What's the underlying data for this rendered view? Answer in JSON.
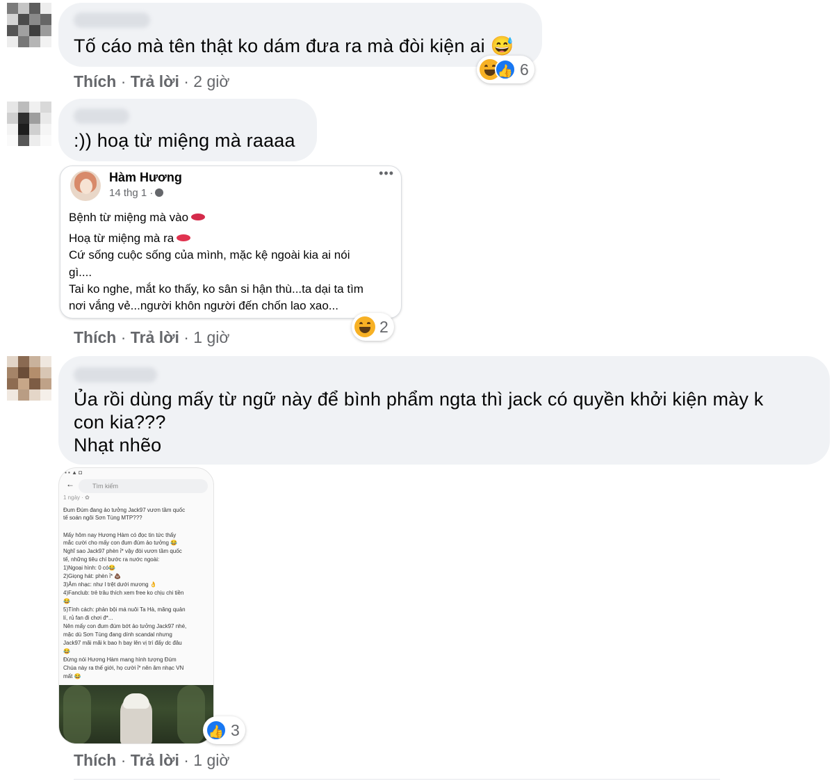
{
  "comments": [
    {
      "text": "Tố cáo mà tên thật ko dám đưa ra mà đòi kiện ai 😅",
      "actions": {
        "like": "Thích",
        "reply": "Trả lời",
        "time": "2 giờ"
      },
      "reactions": {
        "icons": [
          "haha-icon",
          "like-icon"
        ],
        "count": "6"
      }
    },
    {
      "text": ":)) hoạ từ miệng mà raaaa",
      "shared_post": {
        "author": "Hàm Hương",
        "meta": "14 thg 1 ·",
        "more": "•••",
        "lines": [
          "Bệnh từ miệng mà vào",
          "Hoạ từ miệng mà ra",
          "Cứ sống cuộc sống của mình, mặc kệ ngoài kia ai nói",
          "gì....",
          "Tai ko nghe, mắt ko thấy, ko sân si hận thù...ta dại ta tìm",
          "nơi vắng vẻ...người khôn người đến chốn lao xao..."
        ]
      },
      "actions": {
        "like": "Thích",
        "reply": "Trả lời",
        "time": "1 giờ"
      },
      "reactions": {
        "icons": [
          "haha-icon"
        ],
        "count": "2"
      }
    },
    {
      "text_lines": [
        "Ủa rồi dùng mấy từ ngữ này để bình phẩm ngta thì jack có quyền khởi kiện mày k",
        "con kia???",
        "Nhạt nhẽo"
      ],
      "screenshot": {
        "search_placeholder": "Tìm kiếm",
        "lines": [
          "1 ngày · ✿",
          "Đum Đúm đang ảo tưởng Jack97 vươn tầm quốc",
          "tế soán ngôi Sơn Tùng MTP???",
          "",
          "Mấy hôm nay Hương Hàm có đọc tin tức thấy",
          "mắc cười cho mấy con đum đúm ảo tưởng 😂",
          "Nghĩ sao Jack97 phèn ỉ* vậy đòi vươn tầm quốc",
          "tế, những tiêu chí bước ra nước ngoài:",
          "1)Ngoại hình: 0 có😂",
          "2)Giọng hát: phèn ỉ* 💩",
          "3)Âm nhạc: như l trệt dưới mương 👌",
          "4)Fanclub: trẻ trâu thích xem free ko chịu chi tiền",
          "😂",
          "5)Tính cách: phản bội má nuôi Ta Hà, măng quản",
          "lí, rủ fan đi chơi đ*...",
          "Nên mấy con đum đúm bớt ảo tưởng Jack97 nhé,",
          "mặc dù Sơn Tùng đang dính scandal nhưng",
          "Jack97 mãi mãi k bao h bay lên vị trí đấy dc đâu",
          "😂",
          "Đừng nói Hương Hàm mang hình tượng Đúm",
          "Chúa này ra thế giới, họ cười ỉ* nên âm nhạc VN",
          "mất 😂"
        ]
      },
      "actions": {
        "like": "Thích",
        "reply": "Trả lời",
        "time": "1 giờ"
      },
      "reactions": {
        "icons": [
          "like-icon"
        ],
        "count": "3"
      }
    }
  ],
  "colors": {
    "bubble": "#f0f2f5",
    "meta": "#65676b",
    "like_blue": "#1877f2",
    "haha_yellow": "#f7b125"
  }
}
